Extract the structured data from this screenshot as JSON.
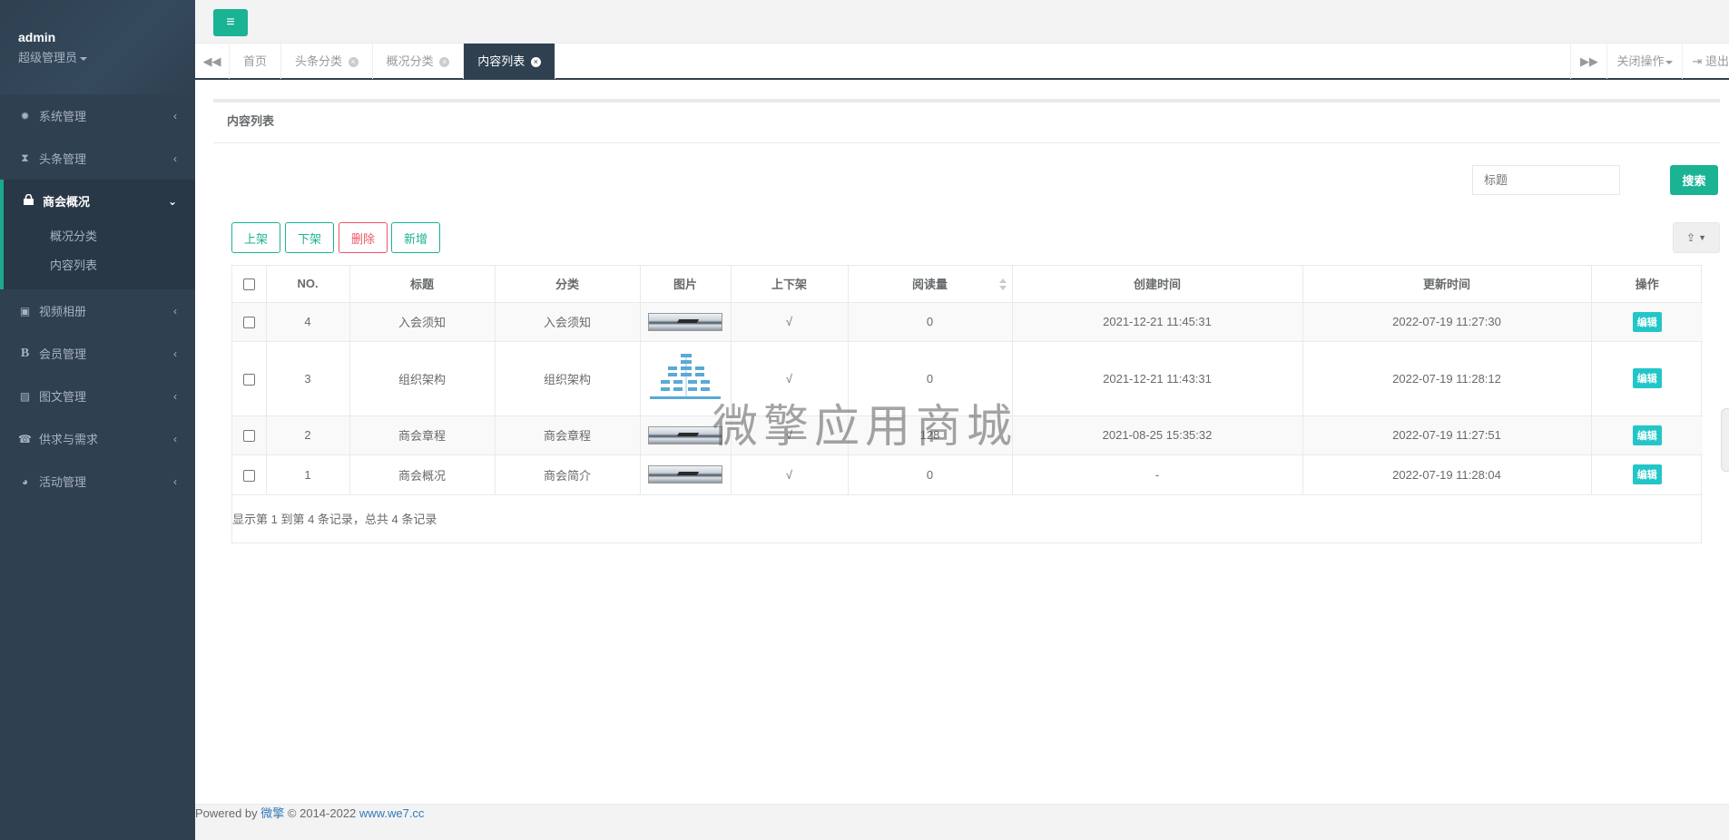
{
  "profile": {
    "name": "admin",
    "role": "超级管理员"
  },
  "sidebar": {
    "items": [
      {
        "label": "系统管理",
        "icon": "gear-icon"
      },
      {
        "label": "头条管理",
        "icon": "hourglass-icon"
      },
      {
        "label": "商会概况",
        "icon": "lock-icon",
        "children": [
          "概况分类",
          "内容列表"
        ]
      },
      {
        "label": "视频相册",
        "icon": "inbox-icon"
      },
      {
        "label": "会员管理",
        "icon": "bold-icon"
      },
      {
        "label": "图文管理",
        "icon": "picture-icon"
      },
      {
        "label": "供求与需求",
        "icon": "phone-icon"
      },
      {
        "label": "活动管理",
        "icon": "globe-icon"
      }
    ]
  },
  "tabs": {
    "items": [
      "首页",
      "头条分类",
      "概况分类",
      "内容列表"
    ],
    "active": "内容列表",
    "close_ops": "关闭操作",
    "logout": "退出"
  },
  "panel": {
    "title": "内容列表",
    "search_placeholder": "标题",
    "search_button": "搜索",
    "toolbar": {
      "publish": "上架",
      "unpublish": "下架",
      "delete": "删除",
      "add": "新增"
    }
  },
  "table": {
    "columns": [
      "NO.",
      "标题",
      "分类",
      "图片",
      "上下架",
      "阅读量",
      "创建时间",
      "更新时间",
      "操作"
    ],
    "rows": [
      {
        "no": "4",
        "title": "入会须知",
        "category": "入会须知",
        "status": "√",
        "reads": "0",
        "created": "2021-12-21 11:45:31",
        "updated": "2022-07-19 11:27:30",
        "action": "编辑"
      },
      {
        "no": "3",
        "title": "组织架构",
        "category": "组织架构",
        "status": "√",
        "reads": "0",
        "created": "2021-12-21 11:43:31",
        "updated": "2022-07-19 11:28:12",
        "action": "编辑"
      },
      {
        "no": "2",
        "title": "商会章程",
        "category": "商会章程",
        "status": "√",
        "reads": "128",
        "created": "2021-08-25 15:35:32",
        "updated": "2022-07-19 11:27:51",
        "action": "编辑"
      },
      {
        "no": "1",
        "title": "商会概况",
        "category": "商会简介",
        "status": "√",
        "reads": "0",
        "created": "-",
        "updated": "2022-07-19 11:28:04",
        "action": "编辑"
      }
    ],
    "pagination_info": "显示第 1 到第 4 条记录，总共 4 条记录"
  },
  "watermark": "微擎应用商城",
  "footer": {
    "prefix": "Powered by",
    "brand": "微擎",
    "copyright": "© 2014-2022",
    "site": "www.we7.cc"
  },
  "colors": {
    "sidebar": "#2f4050",
    "accent": "#1ab394",
    "danger": "#ed5565",
    "info": "#23c6c8"
  }
}
